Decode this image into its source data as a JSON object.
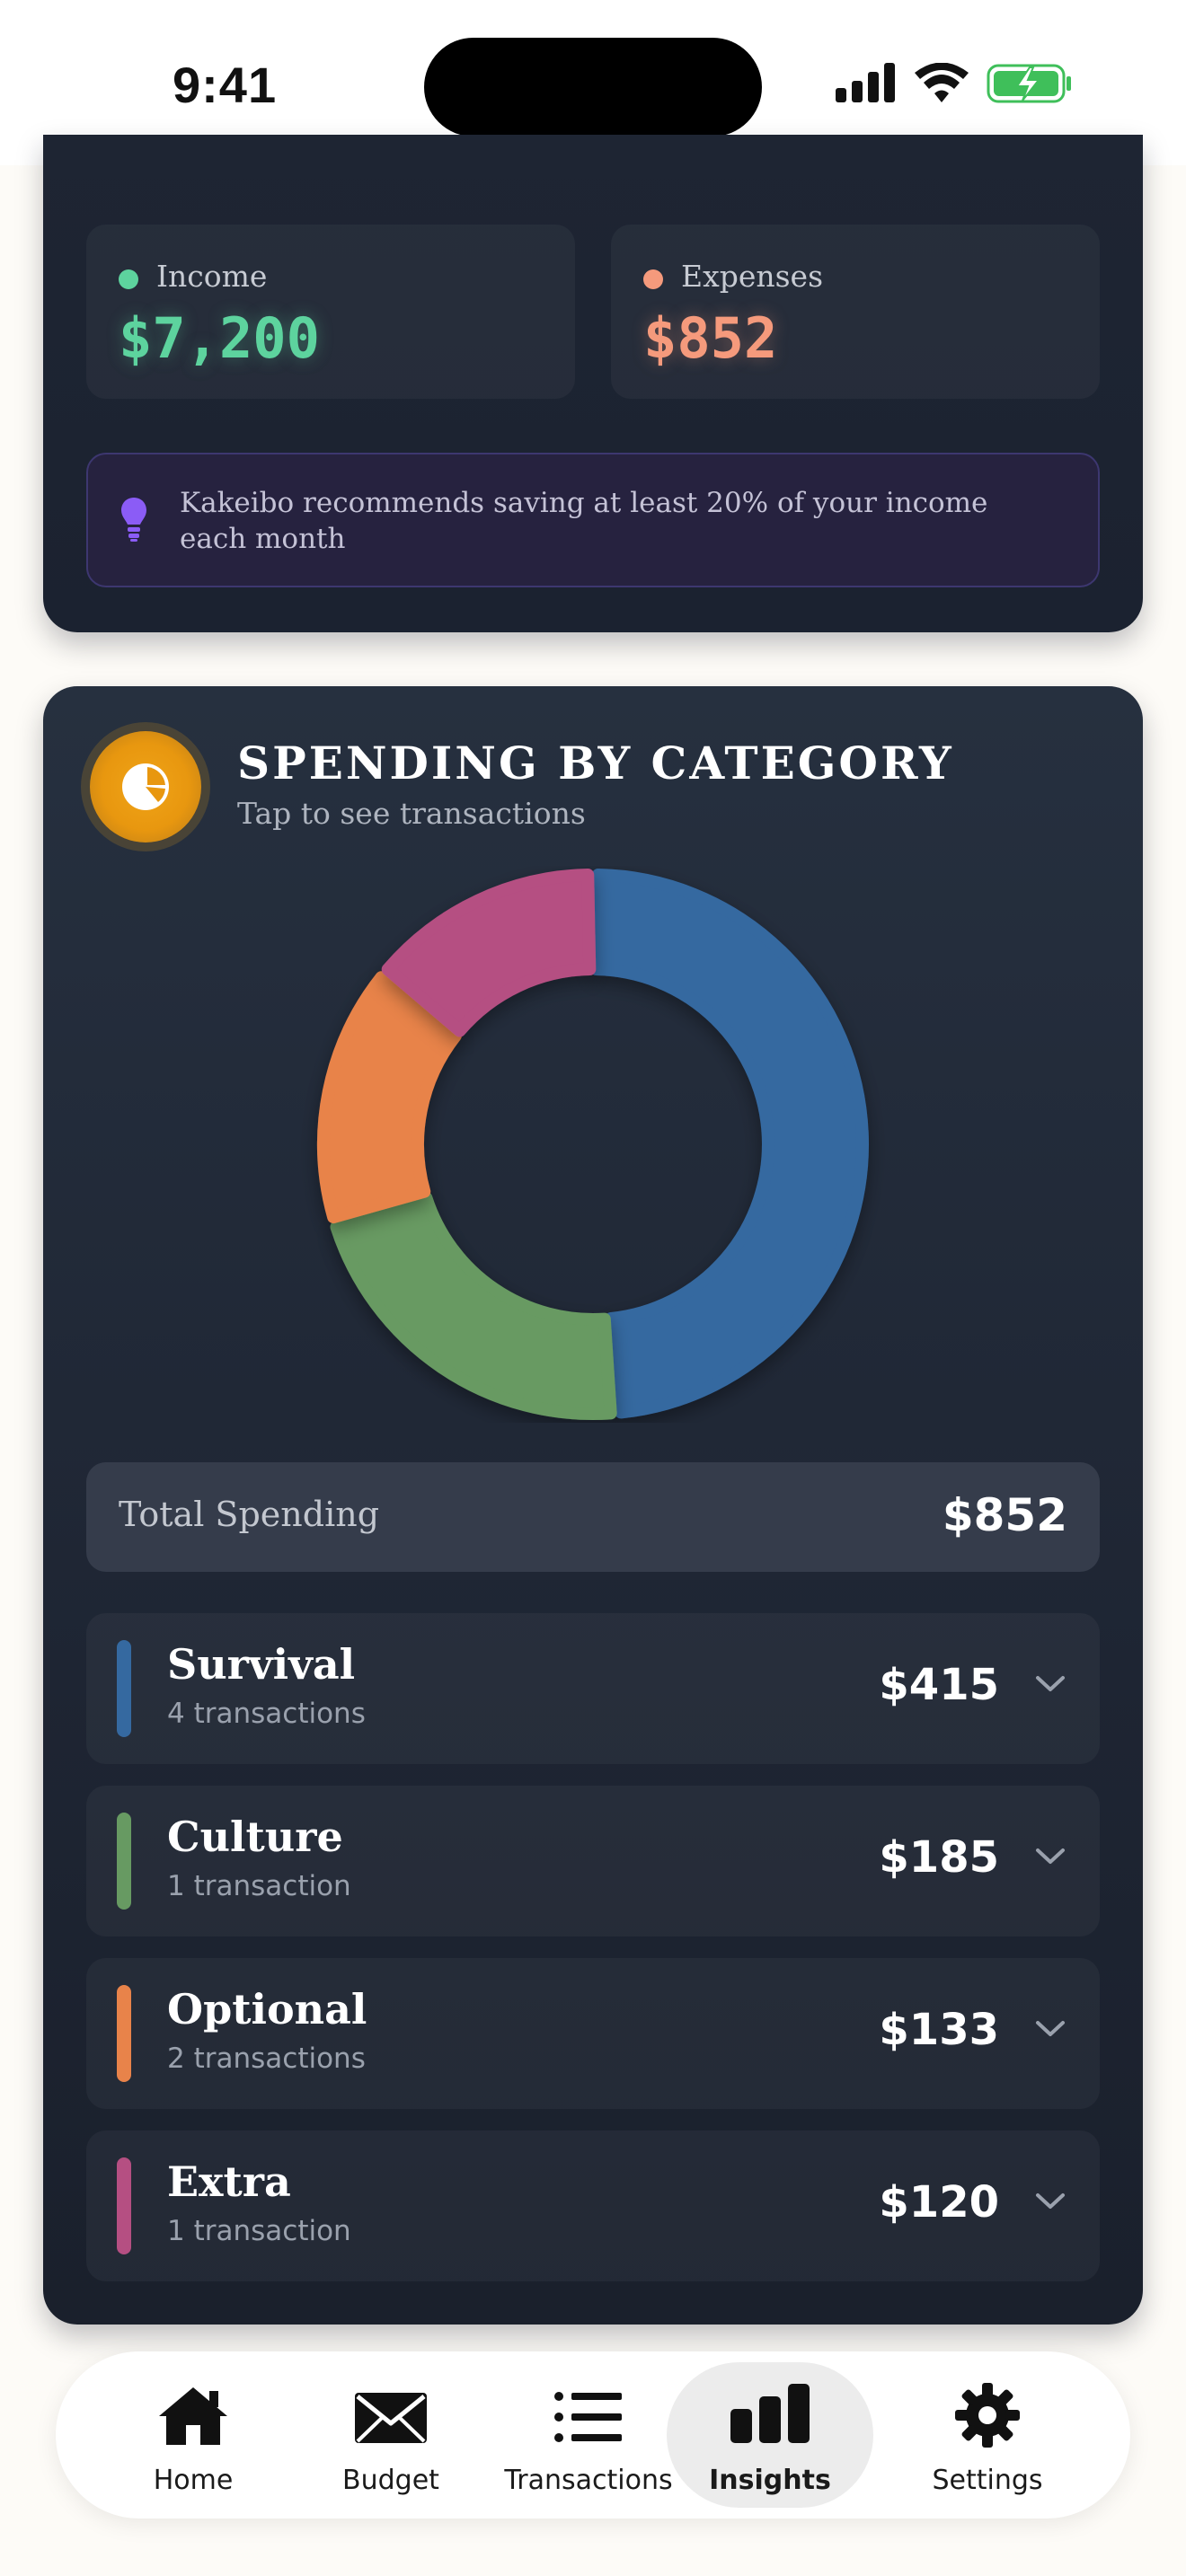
{
  "status_bar": {
    "time": "9:41"
  },
  "summary": {
    "income": {
      "label": "Income",
      "value": "$7,200",
      "color": "#5dd39e"
    },
    "expenses": {
      "label": "Expenses",
      "value": "$852",
      "color": "#f59a7c"
    },
    "tip": {
      "text": "Kakeibo recommends saving at least 20% of your income each month",
      "icon": "lightbulb-icon"
    }
  },
  "spending": {
    "title": "SPENDING BY CATEGORY",
    "subtitle": "Tap to see transactions",
    "icon": "pie-chart-icon",
    "total_label": "Total Spending",
    "total_value": "$852",
    "categories": [
      {
        "name": "Survival",
        "count": "4 transactions",
        "amount": "$415",
        "value": 415,
        "color": "#3569a0"
      },
      {
        "name": "Culture",
        "count": "1 transaction",
        "amount": "$185",
        "value": 185,
        "color": "#679a62"
      },
      {
        "name": "Optional",
        "count": "2 transactions",
        "amount": "$133",
        "value": 133,
        "color": "#e8834a"
      },
      {
        "name": "Extra",
        "count": "1 transaction",
        "amount": "$120",
        "value": 120,
        "color": "#b54f82"
      }
    ]
  },
  "chart_data": {
    "type": "pie",
    "categories": [
      "Survival",
      "Culture",
      "Optional",
      "Extra"
    ],
    "values": [
      415,
      185,
      133,
      120
    ],
    "colors": [
      "#3569a0",
      "#679a62",
      "#e8834a",
      "#b54f82"
    ]
  },
  "tabbar": {
    "active": "Insights",
    "items": [
      {
        "label": "Home",
        "icon": "home-icon"
      },
      {
        "label": "Budget",
        "icon": "envelope-icon"
      },
      {
        "label": "Transactions",
        "icon": "list-icon"
      },
      {
        "label": "Insights",
        "icon": "bar-chart-icon"
      },
      {
        "label": "Settings",
        "icon": "gear-icon"
      }
    ]
  }
}
